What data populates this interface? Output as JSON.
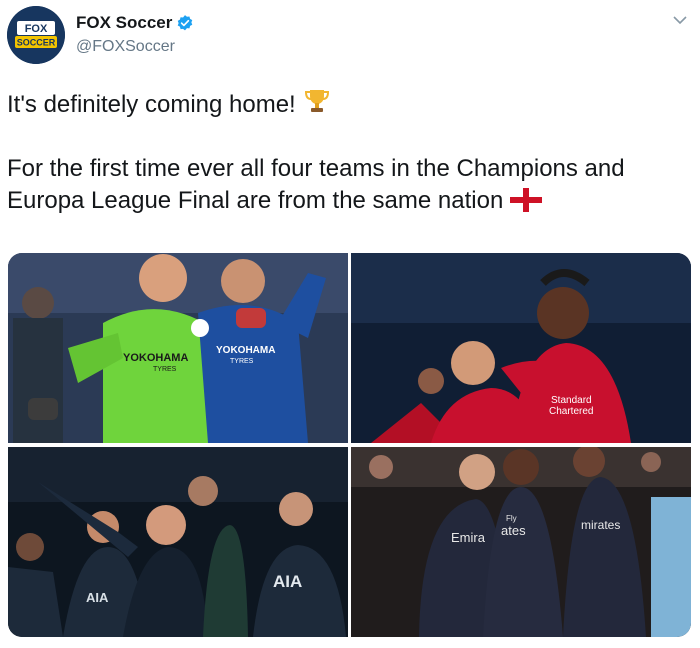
{
  "account": {
    "display_name": "FOX Soccer",
    "handle": "@FOXSoccer",
    "verified": true,
    "avatar_text_top": "FOX",
    "avatar_text_bottom": "SOCCER"
  },
  "tweet": {
    "line1": "It's definitely coming home!",
    "line1_emoji": "trophy-icon",
    "line2": "For the first time ever all four teams in the Champions and Europa League Final are from the same nation",
    "line2_emoji": "england-flag-icon"
  },
  "photos": {
    "chelsea": {
      "kit_sponsor_1": "YOKOHAMA",
      "kit_sponsor_1_sub": "TYRES",
      "kit_sponsor_2": "YOKOHAMA",
      "kit_sponsor_2_sub": "TYRES"
    },
    "liverpool": {
      "kit_sponsor": "Standard",
      "kit_sponsor_2": "Chartered"
    },
    "tottenham": {
      "kit_sponsor_1": "AIA",
      "kit_sponsor_2": "AIA"
    },
    "arsenal": {
      "kit_sponsor_1": "Emira",
      "kit_sponsor_2": "ates",
      "kit_sponsor_3": "mirates",
      "kit_fly": "Fly"
    }
  },
  "colors": {
    "verified": "#1da1f2",
    "handle": "#657786",
    "chelsea_blue": "#1e4fa0",
    "keeper_green": "#6fd43c",
    "liverpool_red": "#c8102e",
    "spurs_navy": "#1d2a3a",
    "arsenal_navy": "#23283b"
  }
}
